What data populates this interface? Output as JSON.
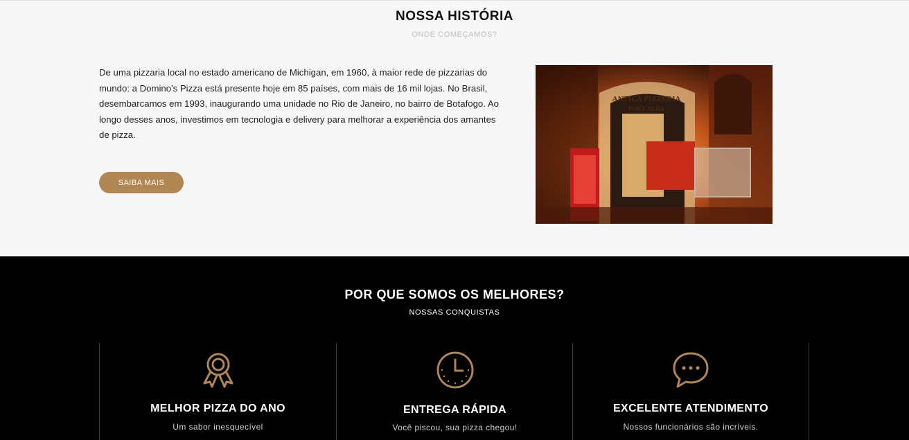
{
  "history": {
    "title": "NOSSA HISTÓRIA",
    "subtitle": "ONDE COMEÇAMOS?",
    "text": "De uma pizzaria local no estado americano de Michigan, em 1960, à maior rede de pizzarias do mundo: a Domino's Pizza está presente hoje em 85 países, com mais de 16 mil lojas. No Brasil, desembarcamos em 1993, inaugurando uma unidade no Rio de Janeiro, no bairro de Botafogo. Ao longo desses anos, investimos em tecnologia e delivery para melhorar a experiência dos amantes de pizza.",
    "button_label": "SAIBA MAIS",
    "photo_sign": "ANTICA PIZZERIA",
    "photo_sign2": "PORT'ALBA"
  },
  "why": {
    "title": "POR QUE SOMOS OS MELHORES?",
    "subtitle": "NOSSAS CONQUISTAS",
    "features": [
      {
        "icon": "award-ribbon-icon",
        "title": "MELHOR PIZZA DO ANO",
        "subtitle": "Um sabor inesquecível"
      },
      {
        "icon": "clock-icon",
        "title": "ENTREGA RÁPIDA",
        "subtitle": "Você piscou, sua pizza chegou!"
      },
      {
        "icon": "chat-bubble-icon",
        "title": "EXCELENTE ATENDIMENTO",
        "subtitle": "Nossos funcionários são incríveis."
      }
    ]
  },
  "colors": {
    "accent": "#b08653",
    "dark_background": "#000000",
    "light_background": "#f7f7f7"
  }
}
